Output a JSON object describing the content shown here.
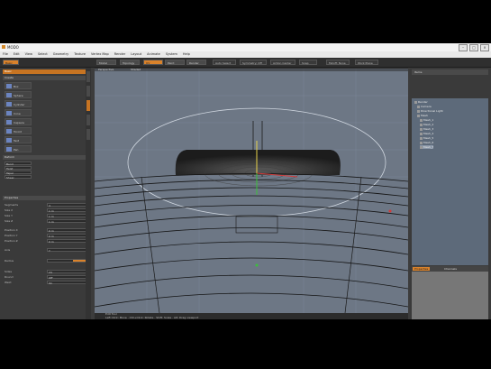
{
  "window": {
    "title": "MODO",
    "controls": [
      "–",
      "□",
      "×"
    ]
  },
  "menu": [
    "File",
    "Edit",
    "View",
    "Select",
    "Geometry",
    "Texture",
    "Vertex Map",
    "Render",
    "Layout",
    "Animate",
    "System",
    "Help"
  ],
  "toolbar": {
    "toolbox_tab": "Basic",
    "tabs": [
      "Model",
      "Topology",
      "UV",
      "Paint",
      "Render"
    ],
    "selectors": [
      "Auto Select",
      "Symmetry: Off",
      "Action Center",
      "Snap",
      "Falloff: None",
      "Work Plane"
    ]
  },
  "left_panel": {
    "header": "Basic",
    "section_title": "Create",
    "tools": [
      "Box",
      "Sphere",
      "Cylinder",
      "Cone",
      "Capsule",
      "Toroid",
      "Text",
      "Pen"
    ],
    "section2_title": "Deform",
    "section2_items": [
      "Bend",
      "Twist",
      "Taper",
      "Shear"
    ],
    "props_header": "Properties",
    "props": [
      {
        "label": "Segments",
        "value": "4"
      },
      {
        "label": "Size X",
        "value": "1 m"
      },
      {
        "label": "Size Y",
        "value": "1 m"
      },
      {
        "label": "Size Z",
        "value": "1 m"
      },
      {
        "label": "Position X",
        "value": "0 m"
      },
      {
        "label": "Position Y",
        "value": "0 m"
      },
      {
        "label": "Position Z",
        "value": "0 m"
      },
      {
        "label": "Axis",
        "value": "Y"
      },
      {
        "label": "Radius",
        "value": "0 m"
      },
      {
        "label": "Sides",
        "value": "24"
      },
      {
        "label": "Round",
        "value": "Off"
      },
      {
        "label": "Weld",
        "value": "On"
      }
    ]
  },
  "viewport": {
    "header_labels": [
      "Perspective",
      "Shaded"
    ],
    "status_lines": [
      "Edit Tool",
      "Left Click: Move · Ctrl+Click: Rotate · Shift: Scale · Alt: Drag viewport"
    ],
    "status_right": "0 Polys"
  },
  "right_panel": {
    "header": "Items",
    "tree": [
      "Render",
      "Camera",
      "Directional Light",
      "Mesh",
      "Mesh_1",
      "Mesh_2",
      "Mesh_3",
      "Mesh_4",
      "Mesh_5",
      "Mesh_6",
      "Mesh_7"
    ],
    "prop_tabs": [
      "Properties",
      "Channels"
    ]
  }
}
